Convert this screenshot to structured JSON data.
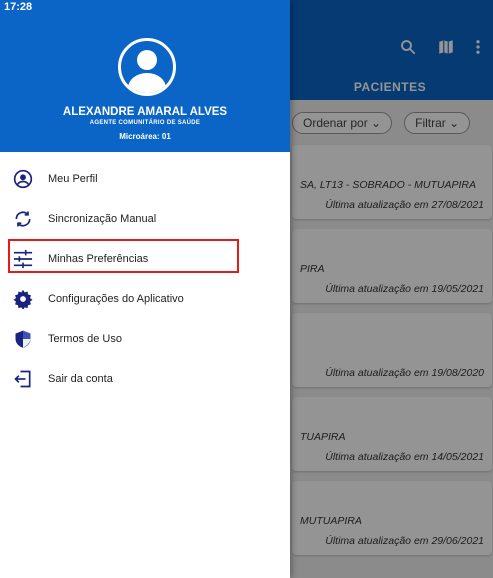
{
  "status": {
    "time": "17:28"
  },
  "background": {
    "tab": "PACIENTES",
    "filters": [
      {
        "label": "Ordenar por"
      },
      {
        "label": "Filtrar"
      }
    ],
    "cards": [
      {
        "address": "SA, LT13 - SOBRADO - MUTUAPIRA",
        "updated": "Última atualização em 27/08/2021"
      },
      {
        "address": "PIRA",
        "updated": "Última atualização em 19/05/2021"
      },
      {
        "address": "",
        "updated": "Última atualização em 19/08/2020"
      },
      {
        "address": "TUAPIRA",
        "updated": "Última atualização em 14/05/2021"
      },
      {
        "address": "MUTUAPIRA",
        "updated": "Última atualização em 29/06/2021"
      }
    ]
  },
  "drawer": {
    "user": {
      "name": "ALEXANDRE AMARAL ALVES",
      "role": "AGENTE COMUNITÁRIO DE SAÚDE",
      "microarea": "Microárea: 01"
    },
    "menu": [
      {
        "label": "Meu Perfil",
        "icon": "account-circle-icon"
      },
      {
        "label": "Sincronização Manual",
        "icon": "sync-icon"
      },
      {
        "label": "Minhas Preferências",
        "icon": "tune-icon"
      },
      {
        "label": "Configurações do Aplicativo",
        "icon": "gear-icon"
      },
      {
        "label": "Termos de Uso",
        "icon": "shield-icon"
      },
      {
        "label": "Sair da conta",
        "icon": "logout-icon"
      }
    ]
  },
  "colors": {
    "primary": "#0b65c6",
    "highlight": "#e51b1b"
  }
}
